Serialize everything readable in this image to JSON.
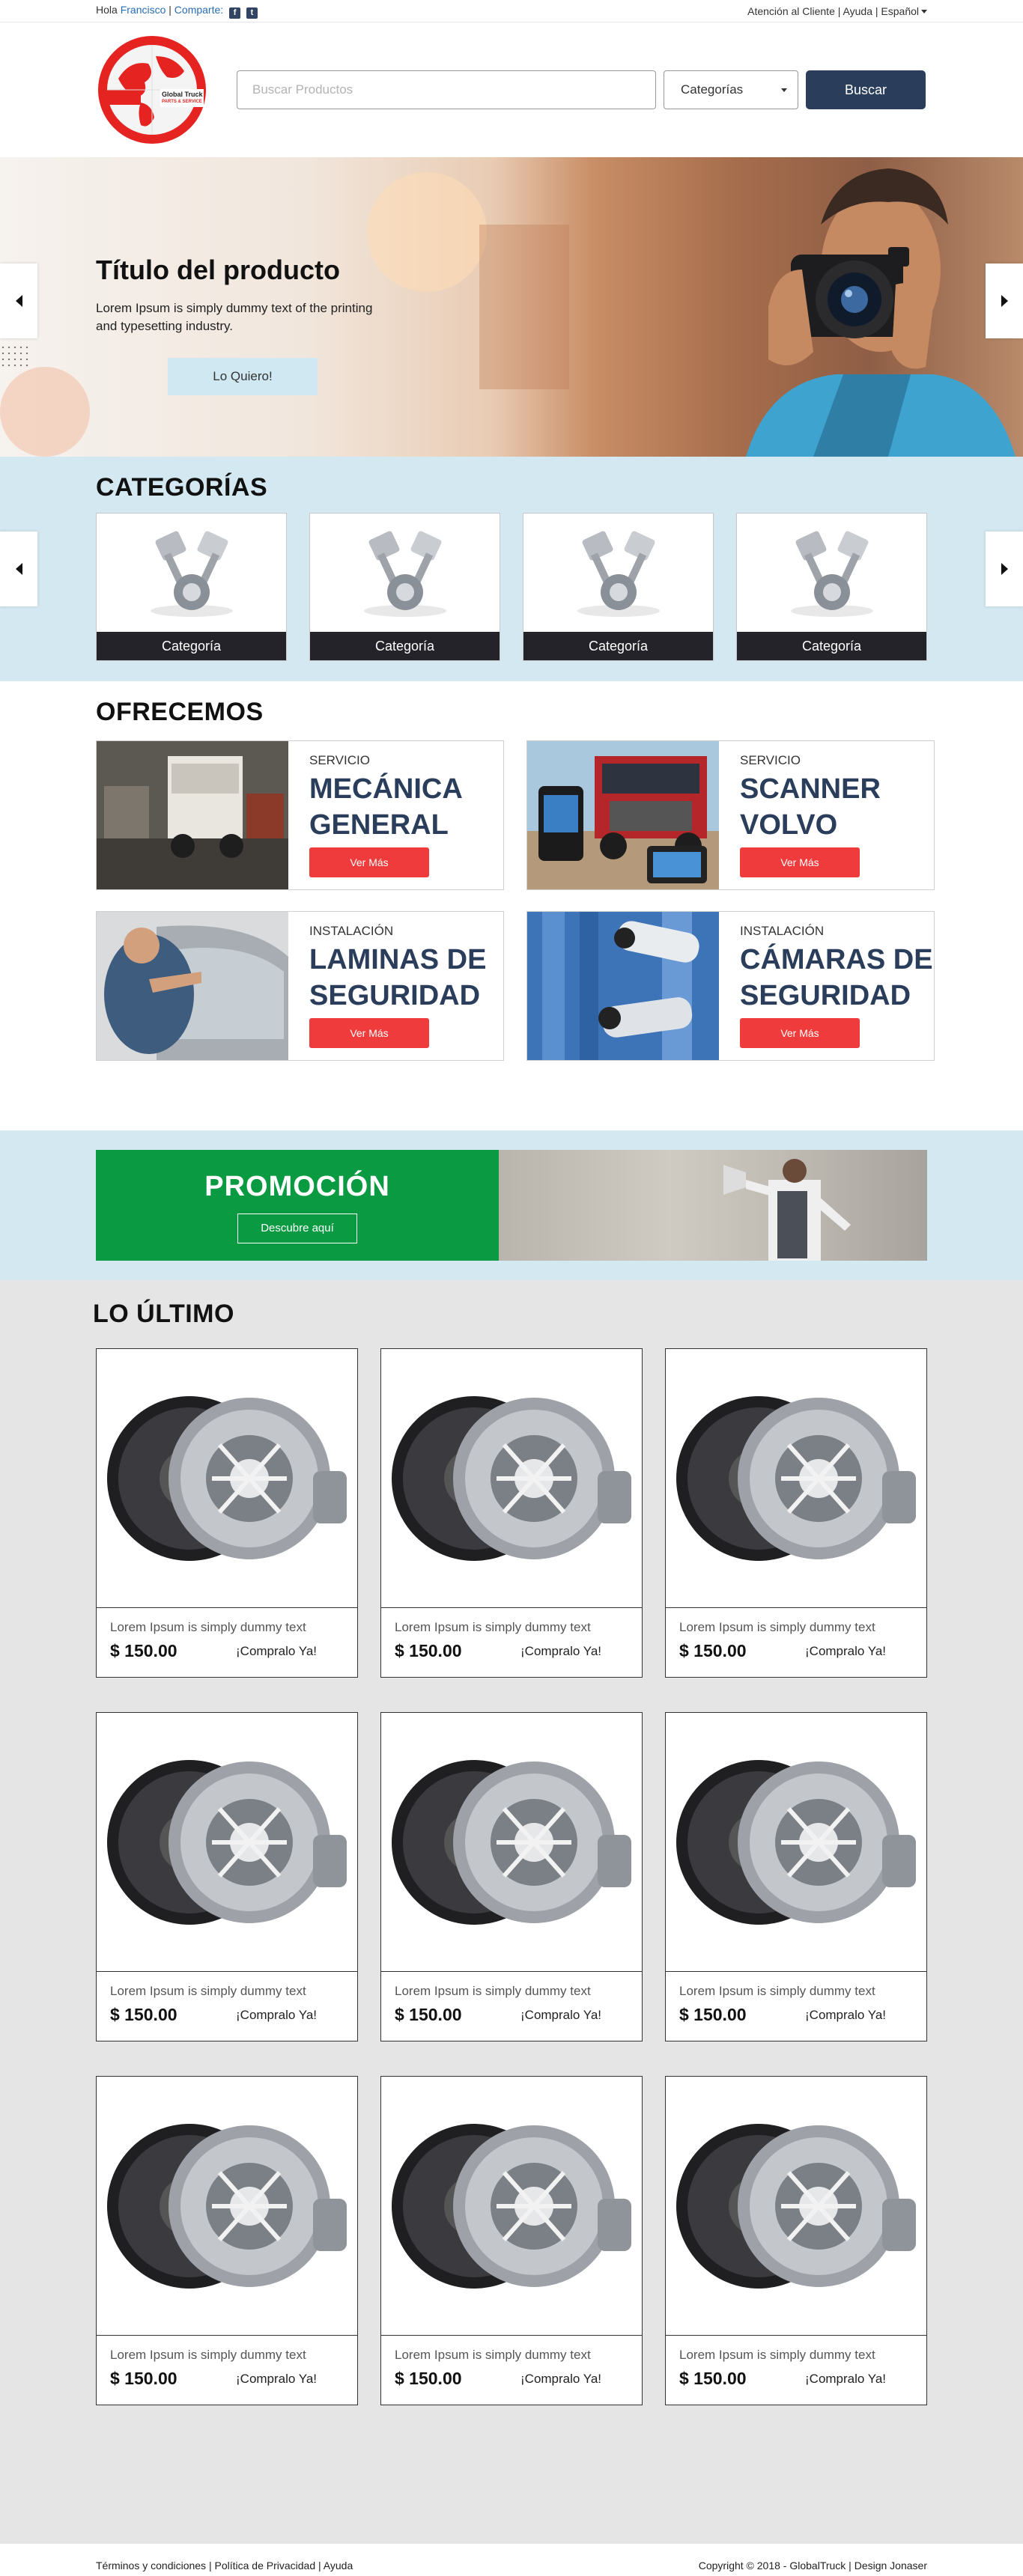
{
  "topbar": {
    "greeting": "Hola",
    "user_name": "Francisco",
    "separator": "|",
    "share_label": "Comparte:",
    "facebook_glyph": "f",
    "twitter_glyph": "t",
    "customer_service": "Atención al Cliente",
    "help": "Ayuda",
    "language": "Español",
    "sep1": "|",
    "sep2": "|"
  },
  "header": {
    "logo_text_1": "Global Truck",
    "logo_text_2": "PARTS & SERVICE",
    "search_placeholder": "Buscar Productos",
    "categories_label": "Categorías",
    "search_button": "Buscar"
  },
  "hero": {
    "title": "Título del producto",
    "description": "Lorem Ipsum is simply dummy text of the printing and typesetting industry.",
    "button": "Lo Quiero!"
  },
  "categories": {
    "title": "CATEGORÍAS",
    "items": [
      {
        "label": "Categoría"
      },
      {
        "label": "Categoría"
      },
      {
        "label": "Categoría"
      },
      {
        "label": "Categoría"
      }
    ]
  },
  "offer": {
    "title": "OFRECEMOS",
    "items": [
      {
        "kind": "SERVICIO",
        "name_1": "MECÁNICA",
        "name_2": "GENERAL",
        "button": "Ver Más"
      },
      {
        "kind": "SERVICIO",
        "name_1": "SCANNER",
        "name_2": "VOLVO",
        "button": "Ver Más"
      },
      {
        "kind": "INSTALACIÓN",
        "name_1": "LAMINAS DE",
        "name_2": "SEGURIDAD",
        "button": "Ver Más"
      },
      {
        "kind": "INSTALACIÓN",
        "name_1": "CÁMARAS DE",
        "name_2": "SEGURIDAD",
        "button": "Ver Más"
      }
    ]
  },
  "promo": {
    "title": "PROMOCIÓN",
    "button": "Descubre aquí"
  },
  "latest": {
    "title": "LO ÚLTIMO",
    "products": [
      {
        "desc": "Lorem Ipsum is simply dummy text",
        "price": "$ 150.00",
        "cta": "¡Compralo Ya!"
      },
      {
        "desc": "Lorem Ipsum is simply dummy text",
        "price": "$ 150.00",
        "cta": "¡Compralo Ya!"
      },
      {
        "desc": "Lorem Ipsum is simply dummy text",
        "price": "$ 150.00",
        "cta": "¡Compralo Ya!"
      },
      {
        "desc": "Lorem Ipsum is simply dummy text",
        "price": "$ 150.00",
        "cta": "¡Compralo Ya!"
      },
      {
        "desc": "Lorem Ipsum is simply dummy text",
        "price": "$ 150.00",
        "cta": "¡Compralo Ya!"
      },
      {
        "desc": "Lorem Ipsum is simply dummy text",
        "price": "$ 150.00",
        "cta": "¡Compralo Ya!"
      },
      {
        "desc": "Lorem Ipsum is simply dummy text",
        "price": "$ 150.00",
        "cta": "¡Compralo Ya!"
      },
      {
        "desc": "Lorem Ipsum is simply dummy text",
        "price": "$ 150.00",
        "cta": "¡Compralo Ya!"
      },
      {
        "desc": "Lorem Ipsum is simply dummy text",
        "price": "$ 150.00",
        "cta": "¡Compralo Ya!"
      }
    ]
  },
  "footer": {
    "terms": "Términos y condiciones",
    "privacy": "Política de Privacidad",
    "help": "Ayuda",
    "sep": "|",
    "copyright": "Copyright © 2018 - GlobalTruck | Design Jonaser"
  },
  "colors": {
    "navy": "#2a3e5c",
    "red": "#ef3b3b",
    "green": "#0a9a42",
    "light_blue": "#d3e8f1",
    "grey_bg": "#e5e5e5"
  },
  "icons": [
    "facebook-icon",
    "twitter-icon",
    "chevron-down-icon",
    "arrow-left-icon",
    "arrow-right-icon"
  ]
}
